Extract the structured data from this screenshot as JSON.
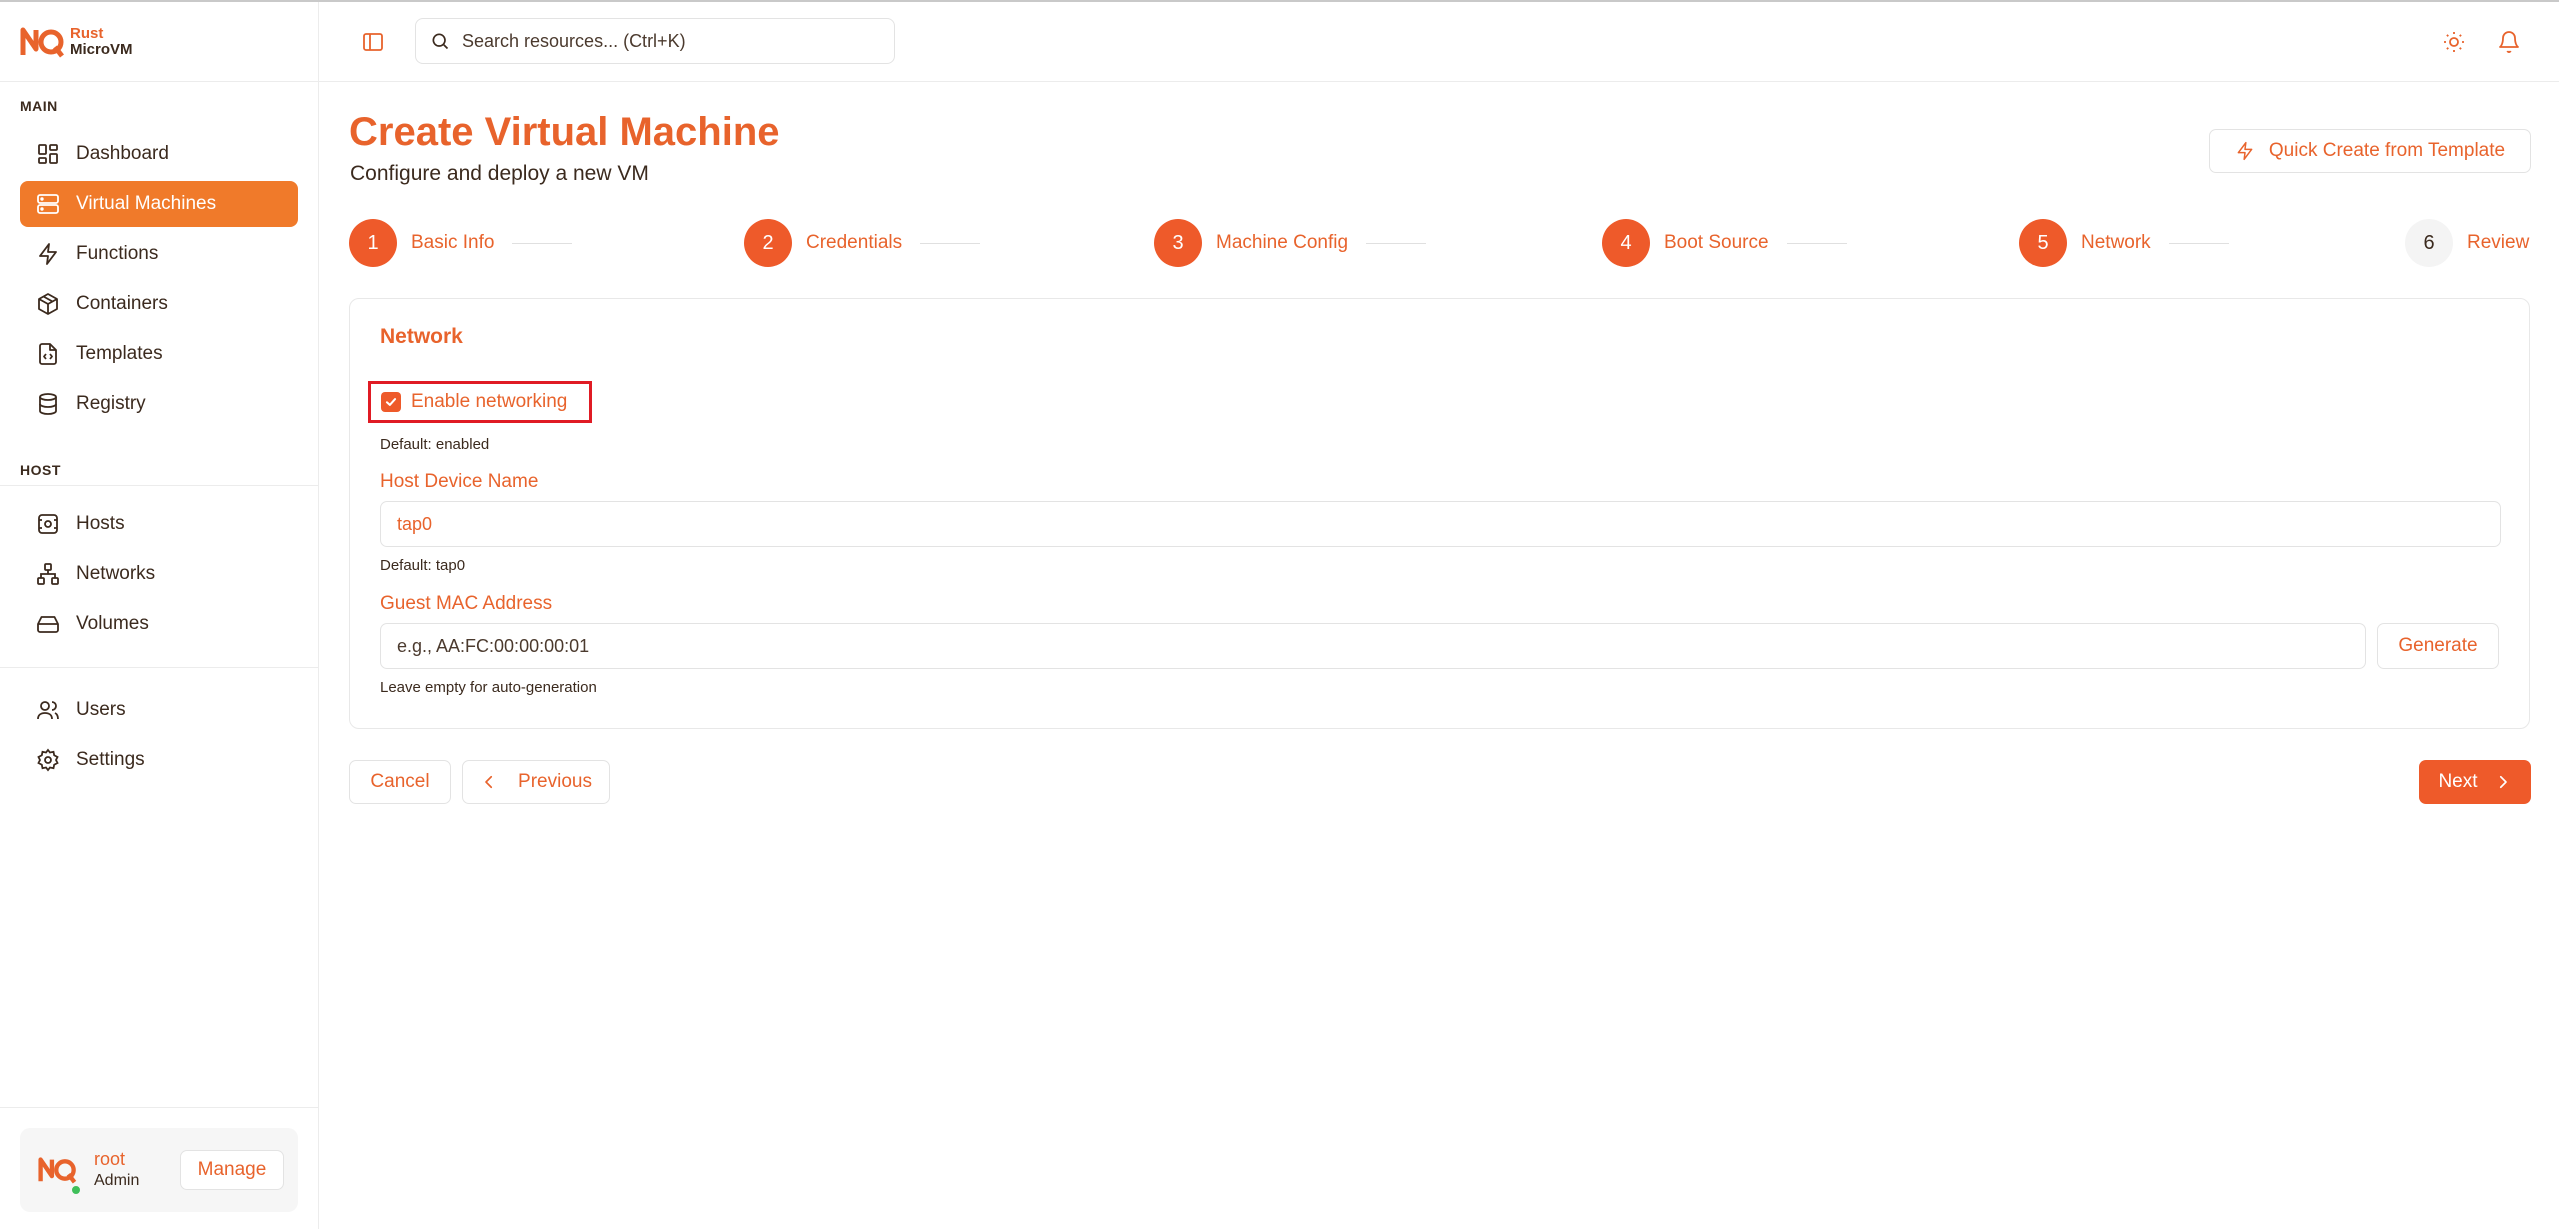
{
  "brand": {
    "line1": "Rust",
    "line2": "MicroVM"
  },
  "sidebar": {
    "main_label": "MAIN",
    "host_label": "HOST",
    "items": [
      {
        "label": "Dashboard",
        "icon": "dashboard-icon"
      },
      {
        "label": "Virtual Machines",
        "icon": "server-icon",
        "active": true
      },
      {
        "label": "Functions",
        "icon": "bolt-icon"
      },
      {
        "label": "Containers",
        "icon": "package-icon"
      },
      {
        "label": "Templates",
        "icon": "file-code-icon"
      },
      {
        "label": "Registry",
        "icon": "database-icon"
      },
      {
        "label": "Hosts",
        "icon": "host-icon"
      },
      {
        "label": "Networks",
        "icon": "network-icon"
      },
      {
        "label": "Volumes",
        "icon": "drive-icon"
      },
      {
        "label": "Users",
        "icon": "users-icon"
      },
      {
        "label": "Settings",
        "icon": "gear-icon"
      }
    ],
    "user": {
      "name": "root",
      "role": "Admin",
      "manage_label": "Manage"
    }
  },
  "topbar": {
    "search_placeholder": "Search resources... (Ctrl+K)"
  },
  "page": {
    "title": "Create Virtual Machine",
    "subtitle": "Configure and deploy a new VM",
    "quick_create_label": "Quick Create from Template"
  },
  "steps": [
    {
      "number": "1",
      "label": "Basic Info",
      "done": true
    },
    {
      "number": "2",
      "label": "Credentials",
      "done": true
    },
    {
      "number": "3",
      "label": "Machine Config",
      "done": true
    },
    {
      "number": "4",
      "label": "Boot Source",
      "done": true
    },
    {
      "number": "5",
      "label": "Network",
      "done": true
    },
    {
      "number": "6",
      "label": "Review",
      "done": false
    }
  ],
  "network": {
    "section_title": "Network",
    "enable_label": "Enable networking",
    "enable_checked": true,
    "enable_hint": "Default: enabled",
    "host_device_label": "Host Device Name",
    "host_device_placeholder": "tap0",
    "host_device_hint": "Default: tap0",
    "mac_label": "Guest MAC Address",
    "mac_placeholder": "e.g., AA:FC:00:00:00:01",
    "mac_hint": "Leave empty for auto-generation",
    "generate_label": "Generate"
  },
  "actions": {
    "cancel": "Cancel",
    "previous": "Previous",
    "next": "Next"
  },
  "colors": {
    "accent": "#ee5a2a",
    "sidebar_active": "#f07a2a",
    "highlight": "#e01b24"
  }
}
